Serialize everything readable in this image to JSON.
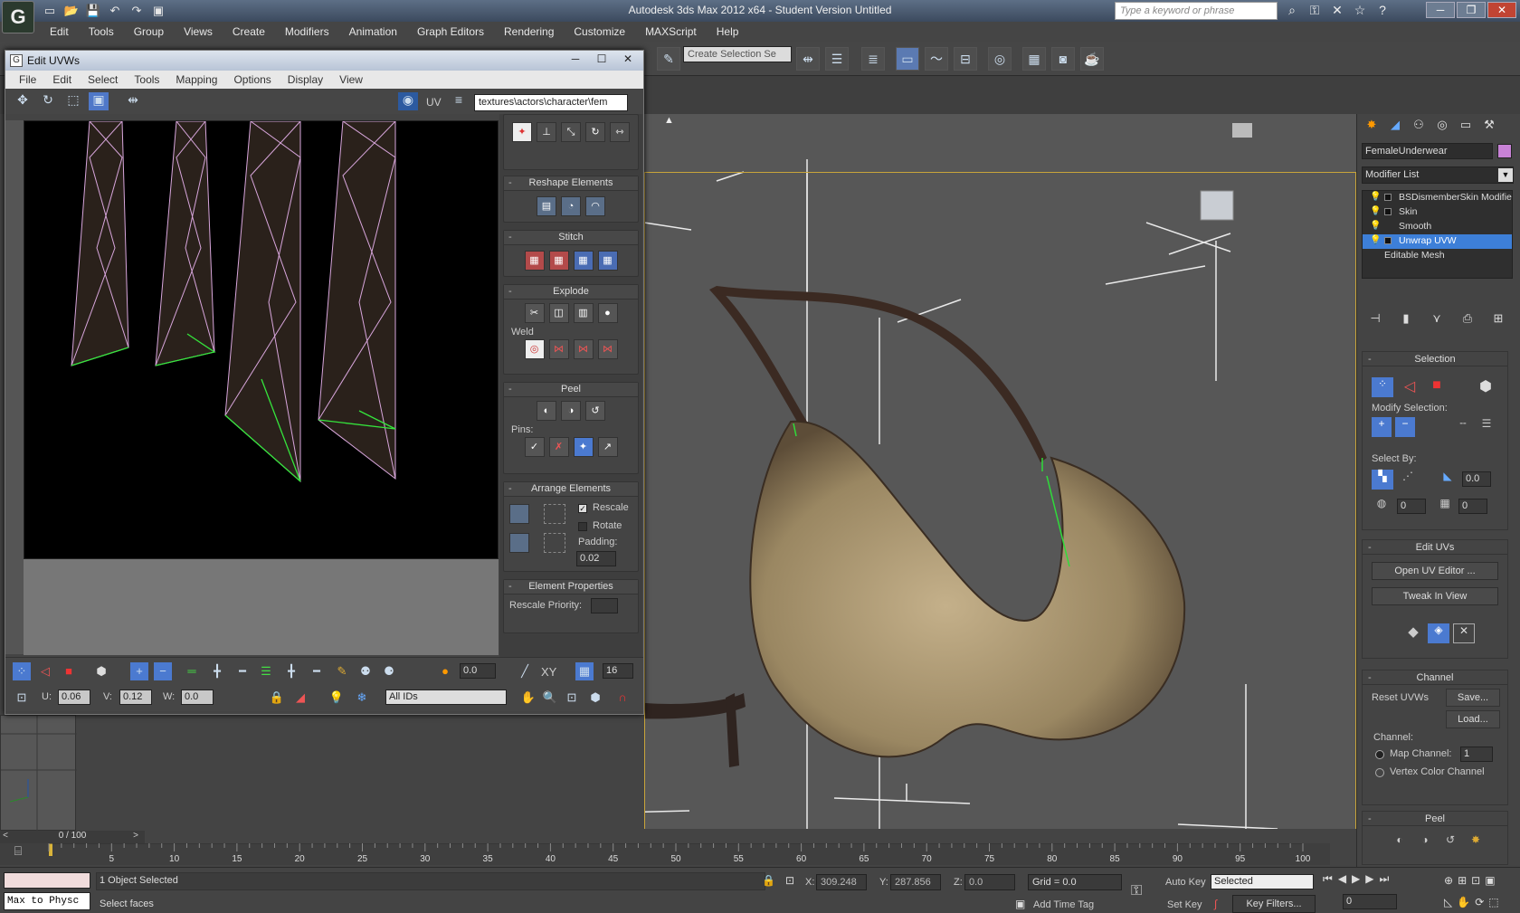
{
  "app": {
    "title": "Autodesk 3ds Max  2012 x64   - Student Version   Untitled",
    "logo_text": "G",
    "search_placeholder": "Type a keyword or phrase",
    "menus": [
      "Edit",
      "Tools",
      "Group",
      "Views",
      "Create",
      "Modifiers",
      "Animation",
      "Graph Editors",
      "Rendering",
      "Customize",
      "MAXScript",
      "Help"
    ],
    "selection_set": "Create Selection Se"
  },
  "uvw_editor": {
    "title": "Edit UVWs",
    "menus": [
      "File",
      "Edit",
      "Select",
      "Tools",
      "Mapping",
      "Options",
      "Display",
      "View"
    ],
    "uv_label": "UV",
    "texture": "textures\\actors\\character\\fem",
    "rollouts": {
      "reshape": "Reshape Elements",
      "stitch": "Stitch",
      "explode": "Explode",
      "weld": "Weld",
      "peel": "Peel",
      "pins": "Pins:",
      "arrange": "Arrange Elements",
      "rescale": "Rescale",
      "rotate": "Rotate",
      "padding_label": "Padding:",
      "padding_value": "0.02",
      "element_props": "Element Properties",
      "rescale_priority": "Rescale Priority:"
    },
    "bottom": {
      "spin_value": "0.0",
      "xy": "XY",
      "grid_value": "16",
      "u_label": "U:",
      "u_value": "0.06",
      "v_label": "V:",
      "v_value": "0.12",
      "w_label": "W:",
      "w_value": "0.0",
      "ids": "All IDs"
    }
  },
  "command_panel": {
    "object_name": "FemaleUnderwear",
    "object_color": "#c882d6",
    "modifier_list": "Modifier List",
    "stack": [
      {
        "label": "BSDismemberSkin Modifie",
        "selected": false
      },
      {
        "label": "Skin",
        "selected": false
      },
      {
        "label": "Smooth",
        "selected": false
      },
      {
        "label": "Unwrap UVW",
        "selected": true
      }
    ],
    "stack_base": "Editable Mesh",
    "selection_title": "Selection",
    "modify_selection": "Modify Selection:",
    "select_by": "Select By:",
    "select_by_value1": "0.0",
    "select_by_value2": "0",
    "select_by_value3": "0",
    "edit_uvs_title": "Edit UVs",
    "open_uv_editor": "Open UV Editor ...",
    "tweak_in_view": "Tweak In View",
    "channel_title": "Channel",
    "reset_uvws": "Reset UVWs",
    "save": "Save...",
    "load": "Load...",
    "channel_label": "Channel:",
    "map_channel": "Map Channel:",
    "map_channel_value": "1",
    "vertex_color_channel": "Vertex Color Channel",
    "peel_title": "Peel"
  },
  "timeline": {
    "frame": "0 / 100",
    "ticks": [
      "5",
      "10",
      "15",
      "20",
      "25",
      "30",
      "35",
      "40",
      "45",
      "50",
      "55",
      "60",
      "65",
      "70",
      "75",
      "80",
      "85",
      "90",
      "95",
      "100"
    ]
  },
  "status": {
    "listener": "Max to Physc",
    "line1": "1 Object Selected",
    "line2": "Select faces",
    "x_label": "X:",
    "x_value": "309.248",
    "y_label": "Y:",
    "y_value": "287.856",
    "z_label": "Z:",
    "z_value": "0.0",
    "grid": "Grid = 0.0",
    "auto_key": "Auto Key",
    "key_mode": "Selected",
    "set_key": "Set Key",
    "key_filters": "Key Filters...",
    "add_time_tag": "Add Time Tag",
    "frame_field": "0"
  }
}
